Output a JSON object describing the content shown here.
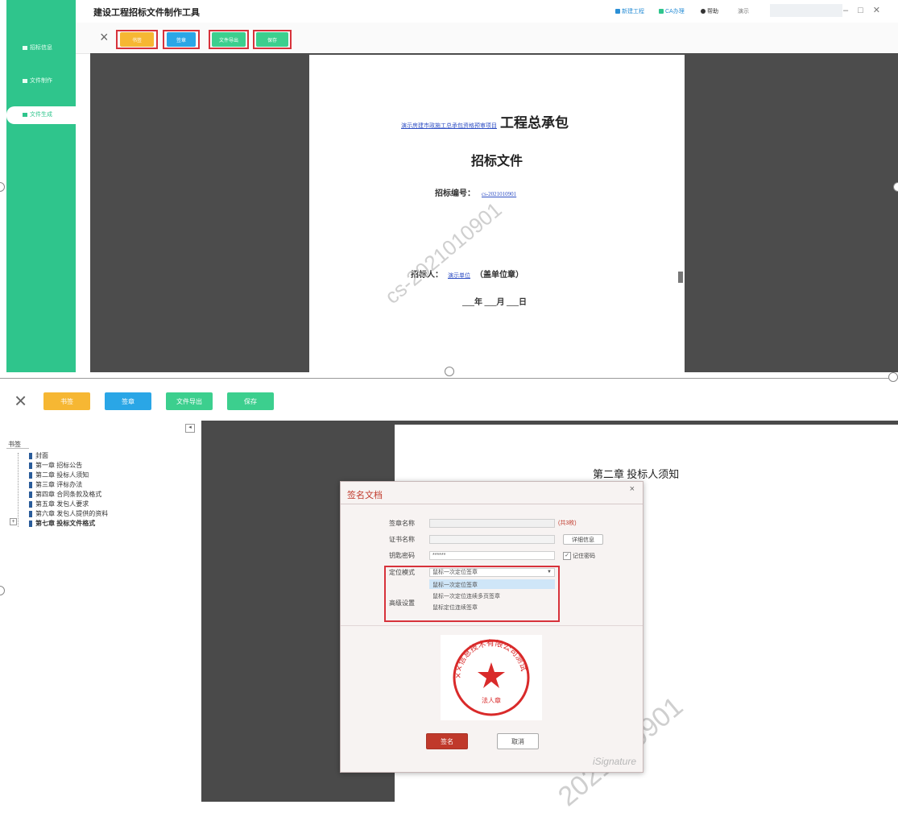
{
  "top": {
    "app_title": "建设工程招标文件制作工具",
    "sidebar": [
      "招标信息",
      "文件制作",
      "文件生成"
    ],
    "titlebar_right": [
      "新建工程",
      "CA办理",
      "帮助",
      "演示"
    ],
    "toolbar": [
      "书签",
      "签章",
      "文件导出",
      "保存"
    ],
    "document": {
      "project_link": "演示房建市政施工总承包资格预审项目",
      "project_suffix": "工程总承包",
      "title": "招标文件",
      "code_label": "招标编号：",
      "code_value": "cs-2021010901",
      "tenderer_label": "招标人：",
      "tenderer_value": "演示单位",
      "tenderer_suffix": "（盖单位章）",
      "date_line": "___年 ___月 ___日",
      "watermark": "cs-2021010901"
    }
  },
  "bottom": {
    "toolbar": [
      "书签",
      "签章",
      "文件导出",
      "保存"
    ],
    "bookmark_header": "书签",
    "tree": [
      "封面",
      "第一章 招标公告",
      "第二章 投标人须知",
      "第三章 评标办法",
      "第四章 合同条款及格式",
      "第五章 发包人要求",
      "第六章 发包人提供的资料",
      "第七章 投标文件格式"
    ],
    "doc_chapter": "第二章 投标人须知",
    "watermark": "2021010901",
    "dialog": {
      "title": "签名文档",
      "close": "×",
      "seal_name_label": "签章名称",
      "seal_count": "(共3枚)",
      "cert_name_label": "证书名称",
      "detail_button": "详细信息",
      "pin_label": "钥匙密码",
      "pin_value": "******",
      "remember_label": "记住密码",
      "mode_label": "定位模式",
      "mode_value": "鼠标一次定位签章",
      "advanced_label": "高级设置",
      "options": [
        "鼠标一次定位签章",
        "鼠标一次定位连续多页签章",
        "鼠标定位连续签章"
      ],
      "seal_text": "××信息技术有限公司测试",
      "seal_bottom": "法人章",
      "sign_button": "签名",
      "cancel_button": "取消",
      "brand": "iSignature"
    }
  },
  "colors": {
    "sidebar_green": "#2fc58c",
    "btn_yellow": "#f6b733",
    "btn_blue": "#2aa6e6",
    "btn_green": "#3ccf8e",
    "highlight_red": "#d7323b"
  }
}
